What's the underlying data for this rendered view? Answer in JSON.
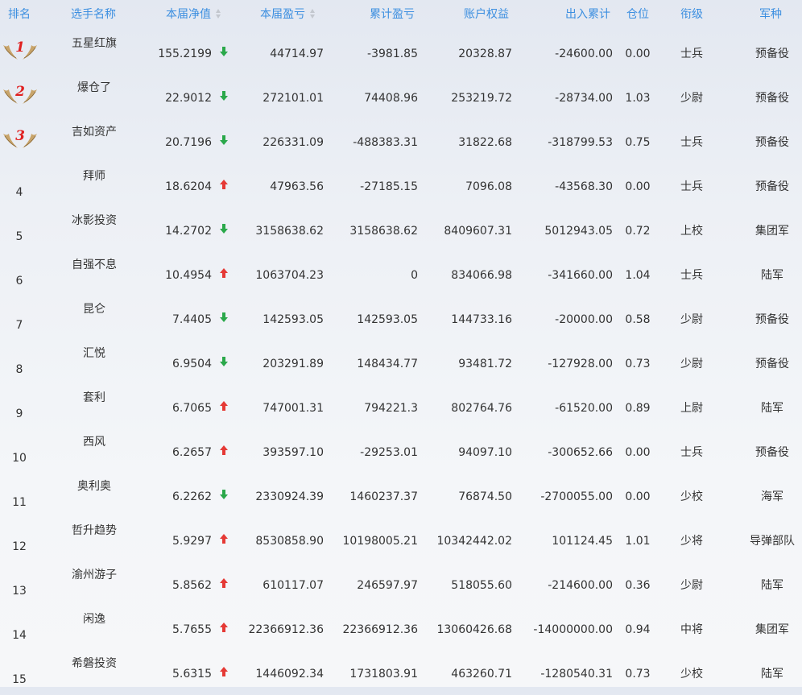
{
  "colors": {
    "header_text": "#3d8fe0",
    "arrow_up": "#e53935",
    "arrow_down": "#2aa84a",
    "medal_gold": "#c8a46a",
    "medal_number": "#e02020"
  },
  "header": {
    "rank": "排名",
    "name": "选手名称",
    "nav": "本届净值",
    "profit": "本届盈亏",
    "cumulative": "累计盈亏",
    "equity": "账户权益",
    "inout": "出入累计",
    "position": "仓位",
    "title": "衔级",
    "branch": "军种"
  },
  "rows": [
    {
      "rank": "1",
      "medal": true,
      "name": "五星红旗",
      "nav": "155.2199",
      "trend": "down",
      "profit": "44714.97",
      "cumulative": "-3981.85",
      "equity": "20328.87",
      "inout": "-24600.00",
      "position": "0.00",
      "title": "士兵",
      "branch": "预备役"
    },
    {
      "rank": "2",
      "medal": true,
      "name": "爆仓了",
      "nav": "22.9012",
      "trend": "down",
      "profit": "272101.01",
      "cumulative": "74408.96",
      "equity": "253219.72",
      "inout": "-28734.00",
      "position": "1.03",
      "title": "少尉",
      "branch": "预备役"
    },
    {
      "rank": "3",
      "medal": true,
      "name": "吉如资产",
      "nav": "20.7196",
      "trend": "down",
      "profit": "226331.09",
      "cumulative": "-488383.31",
      "equity": "31822.68",
      "inout": "-318799.53",
      "position": "0.75",
      "title": "士兵",
      "branch": "预备役"
    },
    {
      "rank": "4",
      "medal": false,
      "name": "拜师",
      "nav": "18.6204",
      "trend": "up",
      "profit": "47963.56",
      "cumulative": "-27185.15",
      "equity": "7096.08",
      "inout": "-43568.30",
      "position": "0.00",
      "title": "士兵",
      "branch": "预备役"
    },
    {
      "rank": "5",
      "medal": false,
      "name": "冰影投资",
      "nav": "14.2702",
      "trend": "down",
      "profit": "3158638.62",
      "cumulative": "3158638.62",
      "equity": "8409607.31",
      "inout": "5012943.05",
      "position": "0.72",
      "title": "上校",
      "branch": "集团军"
    },
    {
      "rank": "6",
      "medal": false,
      "name": "自强不息",
      "nav": "10.4954",
      "trend": "up",
      "profit": "1063704.23",
      "cumulative": "0",
      "equity": "834066.98",
      "inout": "-341660.00",
      "position": "1.04",
      "title": "士兵",
      "branch": "陆军"
    },
    {
      "rank": "7",
      "medal": false,
      "name": "昆仑",
      "nav": "7.4405",
      "trend": "down",
      "profit": "142593.05",
      "cumulative": "142593.05",
      "equity": "144733.16",
      "inout": "-20000.00",
      "position": "0.58",
      "title": "少尉",
      "branch": "预备役"
    },
    {
      "rank": "8",
      "medal": false,
      "name": "汇悦",
      "nav": "6.9504",
      "trend": "down",
      "profit": "203291.89",
      "cumulative": "148434.77",
      "equity": "93481.72",
      "inout": "-127928.00",
      "position": "0.73",
      "title": "少尉",
      "branch": "预备役"
    },
    {
      "rank": "9",
      "medal": false,
      "name": "套利",
      "nav": "6.7065",
      "trend": "up",
      "profit": "747001.31",
      "cumulative": "794221.3",
      "equity": "802764.76",
      "inout": "-61520.00",
      "position": "0.89",
      "title": "上尉",
      "branch": "陆军"
    },
    {
      "rank": "10",
      "medal": false,
      "name": "西风",
      "nav": "6.2657",
      "trend": "up",
      "profit": "393597.10",
      "cumulative": "-29253.01",
      "equity": "94097.10",
      "inout": "-300652.66",
      "position": "0.00",
      "title": "士兵",
      "branch": "预备役"
    },
    {
      "rank": "11",
      "medal": false,
      "name": "奥利奥",
      "nav": "6.2262",
      "trend": "down",
      "profit": "2330924.39",
      "cumulative": "1460237.37",
      "equity": "76874.50",
      "inout": "-2700055.00",
      "position": "0.00",
      "title": "少校",
      "branch": "海军"
    },
    {
      "rank": "12",
      "medal": false,
      "name": "哲升趋势",
      "nav": "5.9297",
      "trend": "up",
      "profit": "8530858.90",
      "cumulative": "10198005.21",
      "equity": "10342442.02",
      "inout": "101124.45",
      "position": "1.01",
      "title": "少将",
      "branch": "导弹部队"
    },
    {
      "rank": "13",
      "medal": false,
      "name": "渝州游子",
      "nav": "5.8562",
      "trend": "up",
      "profit": "610117.07",
      "cumulative": "246597.97",
      "equity": "518055.60",
      "inout": "-214600.00",
      "position": "0.36",
      "title": "少尉",
      "branch": "陆军"
    },
    {
      "rank": "14",
      "medal": false,
      "name": "闲逸",
      "nav": "5.7655",
      "trend": "up",
      "profit": "22366912.36",
      "cumulative": "22366912.36",
      "equity": "13060426.68",
      "inout": "-14000000.00",
      "position": "0.94",
      "title": "中将",
      "branch": "集团军"
    },
    {
      "rank": "15",
      "medal": false,
      "name": "希磐投资",
      "nav": "5.6315",
      "trend": "up",
      "profit": "1446092.34",
      "cumulative": "1731803.91",
      "equity": "463260.71",
      "inout": "-1280540.31",
      "position": "0.73",
      "title": "少校",
      "branch": "陆军"
    }
  ]
}
